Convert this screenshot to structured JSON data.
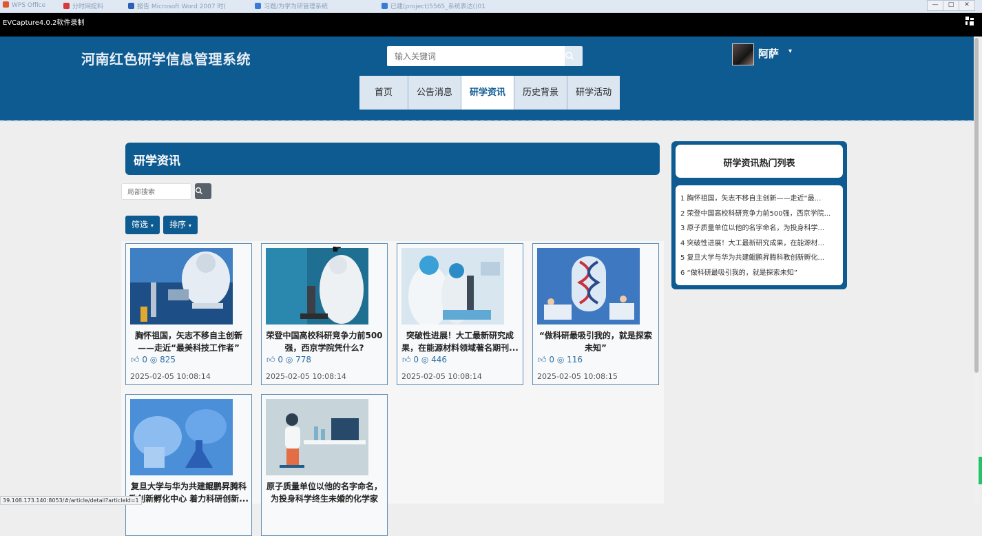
{
  "os": {
    "tabs": [
      "WPS Office",
      "分时网提料",
      "报告 Microsoft Word 2007 时(",
      "习题/为学为研管理系统",
      "已建(project)5565_系统表达()01"
    ],
    "window_buttons": [
      "—",
      "□",
      "✕"
    ]
  },
  "recorder": {
    "title": "EVCapture4.0.2软件录制"
  },
  "header": {
    "site_title": "河南红色研学信息管理系统",
    "search_placeholder": "输入关键词",
    "username": "阿萨",
    "nav": [
      "首页",
      "公告消息",
      "研学资讯",
      "历史背景",
      "研学活动"
    ],
    "active_nav": "研学资讯"
  },
  "main": {
    "section_title": "研学资讯",
    "local_search_placeholder": "局部搜索",
    "filter_label": "筛选",
    "sort_label": "排序",
    "cards": [
      {
        "title": "胸怀祖国，矢志不移自主创新——走近“最美科技工作者”",
        "likes": "0",
        "views": "825",
        "date": "2025-02-05 10:08:14"
      },
      {
        "title": "荣登中国高校科研竞争力前500强，西京学院凭什么?",
        "likes": "0",
        "views": "778",
        "date": "2025-02-05 10:08:14"
      },
      {
        "title": "突破性进展！大工最新研究成果，在能源材料领域著名期刊...",
        "likes": "0",
        "views": "446",
        "date": "2025-02-05 10:08:14"
      },
      {
        "title": "“做科研最吸引我的，就是探索未知”",
        "likes": "0",
        "views": "116",
        "date": "2025-02-05 10:08:15"
      },
      {
        "title": "复旦大学与华为共建鲲鹏昇腾科教创新孵化中心 着力科研创新...",
        "likes": "",
        "views": "",
        "date": ""
      },
      {
        "title": "原子质量单位以他的名字命名，为投身科学终生未婚的化学家",
        "likes": "",
        "views": "",
        "date": ""
      }
    ]
  },
  "hot": {
    "title": "研学资讯热门列表",
    "items": [
      "1 胸怀祖国，矢志不移自主创新——走近“最...",
      "2 荣登中国高校科研竞争力前500强，西京学院...",
      "3 原子质量单位以他的名字命名，为投身科学...",
      "4 突破性进展！大工最新研究成果，在能源材...",
      "5 复旦大学与华为共建鲲鹏昇腾科教创新孵化...",
      "6 “做科研最吸引我的，就是探索未知”"
    ]
  },
  "status_bar": {
    "url": "39.108.173.140:8053/#/article/detail?articleId=1"
  },
  "colors": {
    "brand": "#0e5b91",
    "nav_bg": "#dbe6f1",
    "page_bg": "#eeeeee",
    "link": "#2f6fa5"
  },
  "icons": [
    "search-icon",
    "caret-down-icon",
    "thumbs-up-icon",
    "eye-icon",
    "grid-icon"
  ]
}
